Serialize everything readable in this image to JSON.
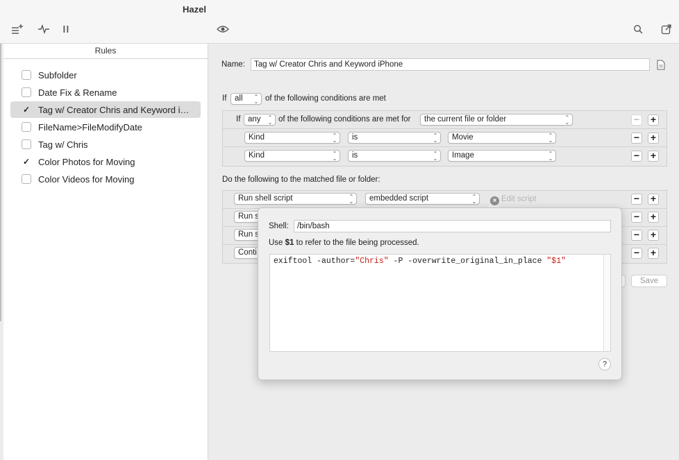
{
  "window": {
    "title": "Hazel"
  },
  "toolbar": {
    "new_rule_icon": "list-add-icon",
    "activity_icon": "activity-pulse-icon",
    "pause_icon": "pause-icon",
    "preview_icon": "eye-icon",
    "search_icon": "search-icon",
    "share_icon": "window-export-icon"
  },
  "sidebar": {
    "header": "Rules",
    "items": [
      {
        "label": "Subfolder",
        "checked": false,
        "selected": false
      },
      {
        "label": "Date Fix & Rename",
        "checked": false,
        "selected": false
      },
      {
        "label": "Tag w/ Creator Chris and Keyword iPhone",
        "checked": true,
        "selected": true
      },
      {
        "label": "FileName>FileModifyDate",
        "checked": false,
        "selected": false
      },
      {
        "label": "Tag w/ Chris",
        "checked": false,
        "selected": false
      },
      {
        "label": "Color Photos for Moving",
        "checked": true,
        "selected": false
      },
      {
        "label": "Color Videos for Moving",
        "checked": false,
        "selected": false
      }
    ]
  },
  "rule": {
    "name_label": "Name:",
    "name_value": "Tag w/ Creator Chris and Keyword iPhone",
    "cond_if": "If",
    "cond_match": "all",
    "cond_suffix": "of the following conditions are met",
    "nested": {
      "if_label": "If",
      "match": "any",
      "suffix": "of the following conditions are met for",
      "target": "the current file or folder",
      "rows": [
        {
          "attribute": "Kind",
          "operator": "is",
          "value": "Movie"
        },
        {
          "attribute": "Kind",
          "operator": "is",
          "value": "Image"
        }
      ]
    },
    "actions_label": "Do the following to the matched file or folder:",
    "actions": [
      {
        "action": "Run shell script",
        "script": "embedded script",
        "edit": "Edit script"
      },
      {
        "action": "Run s"
      },
      {
        "action": "Run s"
      },
      {
        "action": "Conti"
      }
    ],
    "save_label": "Save"
  },
  "popover": {
    "shell_label": "Shell:",
    "shell_value": "/bin/bash",
    "hint_use": "Use",
    "hint_var": "$1",
    "hint_rest": "to refer to the file being processed.",
    "script": {
      "part1": "exiftool -author=",
      "author": "\"Chris\"",
      "part2": " -P -overwrite_original_in_place ",
      "var": "\"$1\""
    },
    "help": "?"
  },
  "colors": {
    "string": "#c41a16",
    "variable": "#2a7f2a",
    "selection": "#dcdcdc"
  }
}
